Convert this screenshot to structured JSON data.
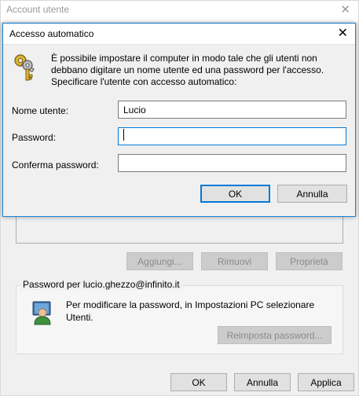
{
  "background_window": {
    "title": "Account utente",
    "close_glyph": "✕",
    "buttons": {
      "add": "Aggiungi...",
      "remove": "Rimuovi",
      "properties": "Proprietà"
    },
    "password_group": {
      "legend": "Password per lucio.ghezzo@infinito.it",
      "text": "Per modificare la password, in Impostazioni PC selezionare Utenti.",
      "reset_button": "Reimposta password..."
    },
    "footer": {
      "ok": "OK",
      "cancel": "Annulla",
      "apply": "Applica"
    }
  },
  "modal": {
    "title": "Accesso automatico",
    "close_glyph": "✕",
    "description": "È possibile impostare il computer in modo tale che gli utenti non debbano digitare un nome utente ed una password per l'accesso. Specificare l'utente con accesso automatico:",
    "fields": {
      "username_label": "Nome utente:",
      "username_value": "Lucio",
      "password_label": "Password:",
      "password_value": "",
      "confirm_label": "Conferma password:",
      "confirm_value": ""
    },
    "ok": "OK",
    "cancel": "Annulla"
  },
  "colors": {
    "accent": "#0078d7",
    "window_bg": "#f0f0f0",
    "disabled_text": "#8a8a8a"
  }
}
